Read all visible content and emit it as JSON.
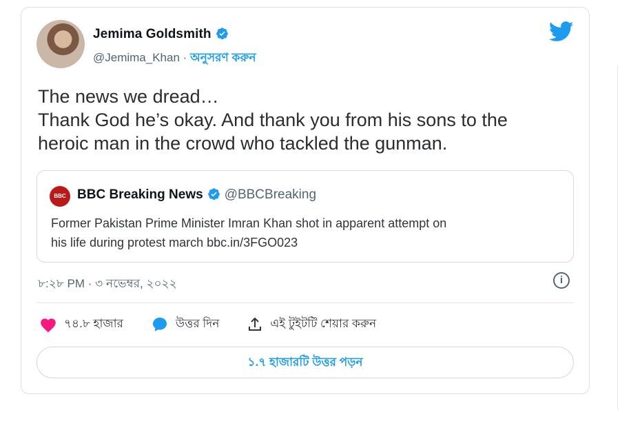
{
  "tweet": {
    "author": {
      "name": "Jemima Goldsmith",
      "handle": "@Jemima_Khan",
      "separator": " · ",
      "follow_label": "অনুসরণ করুন"
    },
    "text_lines": [
      "The news we dread…",
      "Thank God he’s okay. And thank you from his sons to the",
      "heroic man in the crowd who tackled the gunman."
    ],
    "quoted": {
      "logo_text": "BBC NEWS",
      "name": "BBC Breaking News",
      "handle": "@BBCBreaking",
      "text_lines": [
        "Former Pakistan Prime Minister Imran Khan shot in apparent attempt on",
        "his life during protest march bbc.in/3FGO023"
      ]
    },
    "timestamp": "৮:২৮ PM · ৩ নভেম্বর, ২০২২",
    "actions": {
      "likes": "৭৪.৮ হাজার",
      "reply_label": "উত্তর দিন",
      "share_label": "এই টুইটটি শেয়ার করুন"
    },
    "read_replies_label": "১.৭ হাজারটি উত্তর পড়ন"
  },
  "colors": {
    "accent": "#1d9bf0",
    "like": "#f91880",
    "bbc_red": "#bb1919"
  },
  "icons": [
    "verified-badge-icon",
    "twitter-bird-icon",
    "info-icon",
    "heart-icon",
    "reply-bubble-icon",
    "share-icon"
  ]
}
